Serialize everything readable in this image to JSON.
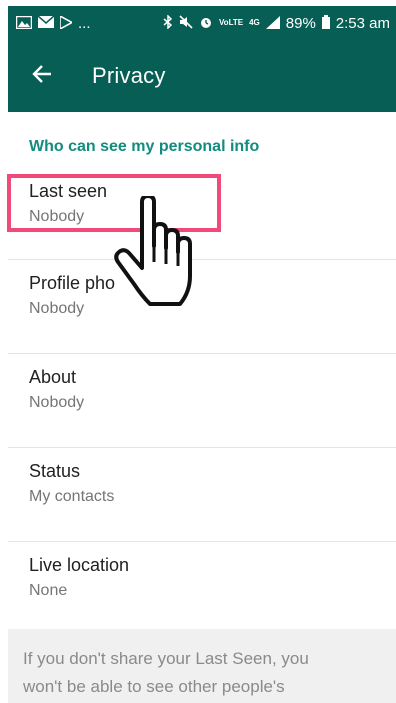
{
  "status_bar": {
    "battery": "89%",
    "time": "2:53 am",
    "volte_label": "VoLTE",
    "network_label": "4G",
    "left_icons": [
      "image-icon",
      "mail-icon",
      "play-store-icon"
    ],
    "left_overflow": "...",
    "right_icons": [
      "bluetooth-icon",
      "mute-icon",
      "alarm-icon",
      "signal-icon",
      "battery-icon"
    ]
  },
  "app_bar": {
    "title": "Privacy",
    "back_icon": "arrow-left-icon"
  },
  "section": {
    "header": "Who can see my personal info"
  },
  "settings": [
    {
      "title": "Last seen",
      "value": "Nobody"
    },
    {
      "title": "Profile pho",
      "value": "Nobody"
    },
    {
      "title": "About",
      "value": "Nobody"
    },
    {
      "title": "Status",
      "value": "My contacts"
    },
    {
      "title": "Live location",
      "value": "None"
    }
  ],
  "footer": {
    "line1": "If you don't share your Last Seen, you",
    "line2": "won't be able to see other people's"
  },
  "colors": {
    "header_bg": "#075e54",
    "accent": "#128c7e",
    "highlight": "#ef4a7a",
    "footer_bg": "#f0f0f0"
  },
  "annotations": {
    "highlight_target": "settings.0",
    "cursor_icon": "hand-pointer-icon"
  }
}
